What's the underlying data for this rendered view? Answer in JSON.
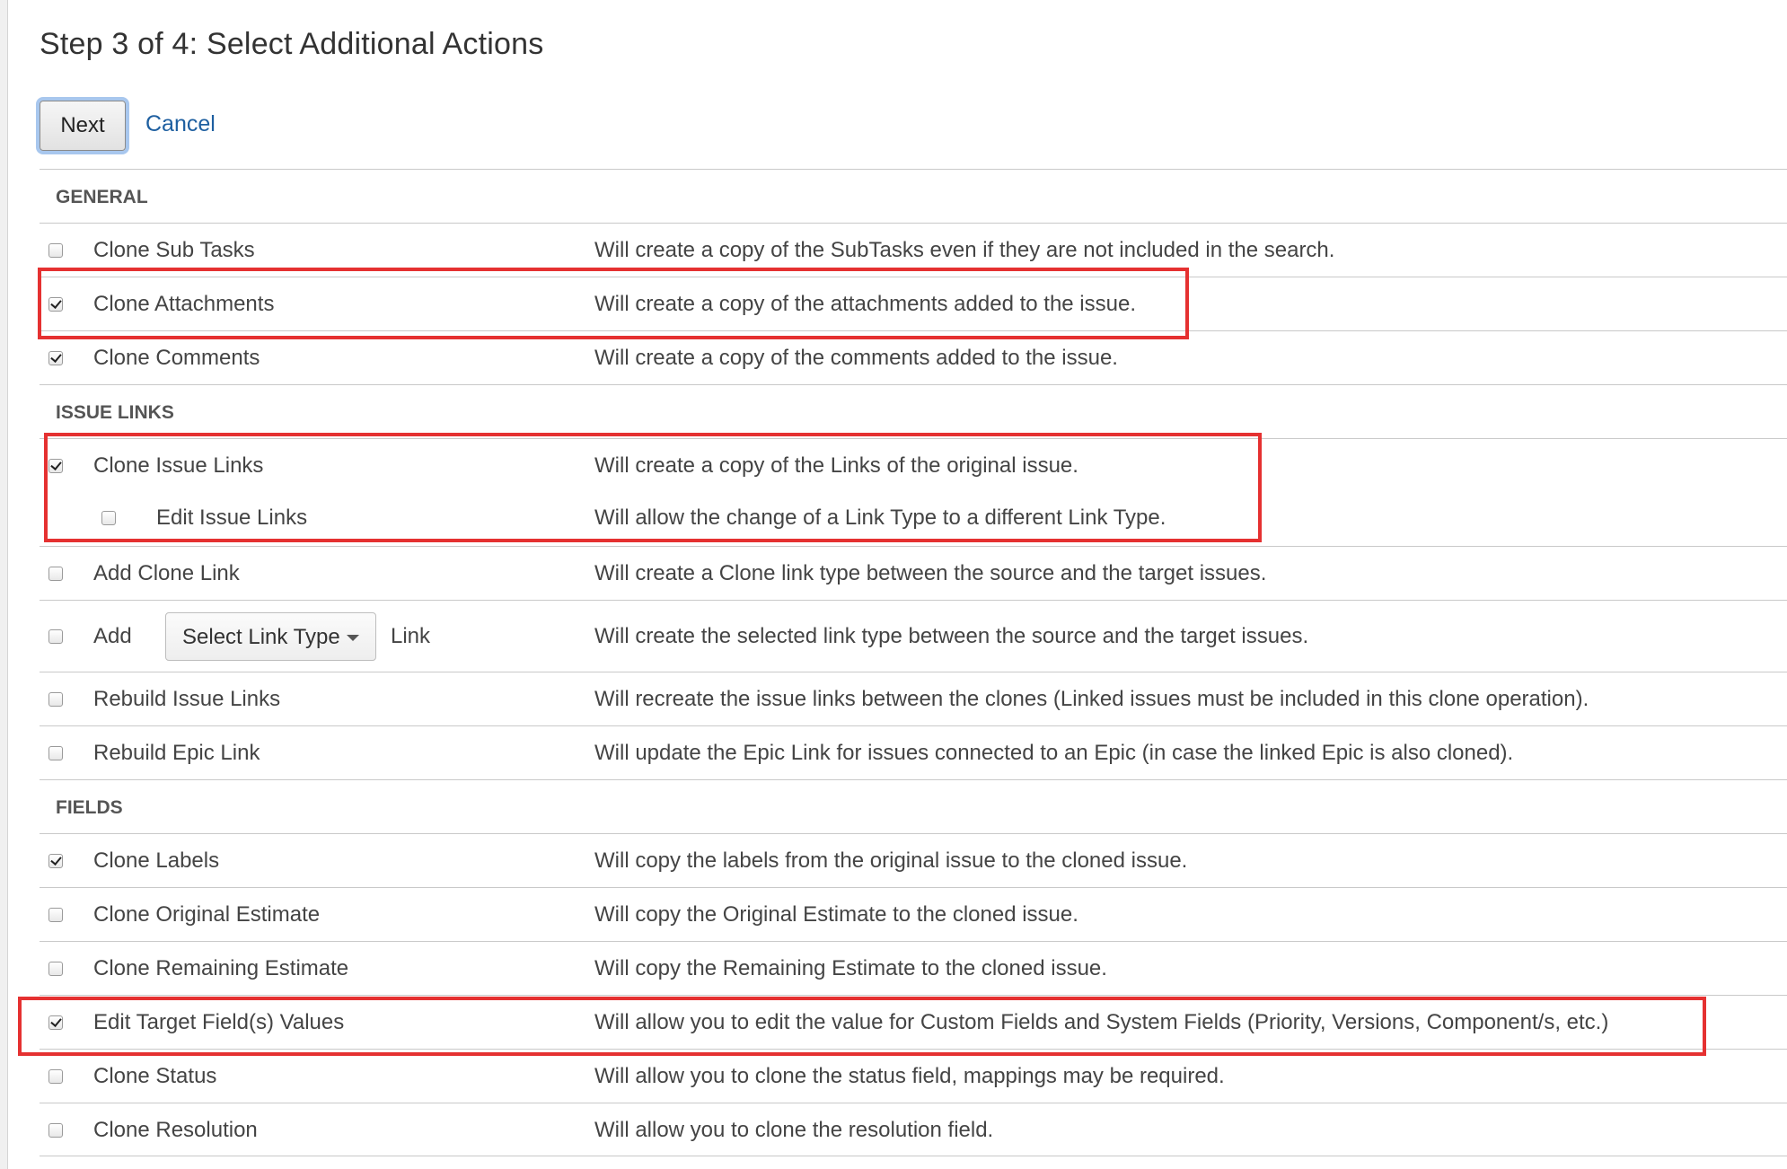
{
  "page": {
    "title": "Step 3 of 4: Select Additional Actions",
    "next_label": "Next",
    "cancel_label": "Cancel"
  },
  "sections": {
    "general": "GENERAL",
    "issue_links": "ISSUE LINKS",
    "fields": "FIELDS"
  },
  "options": {
    "clone_sub_tasks": {
      "label": "Clone Sub Tasks",
      "desc": "Will create a copy of the SubTasks even if they are not included in the search.",
      "checked": false
    },
    "clone_attachments": {
      "label": "Clone Attachments",
      "desc": "Will create a copy of the attachments added to the issue.",
      "checked": true
    },
    "clone_comments": {
      "label": "Clone Comments",
      "desc": "Will create a copy of the comments added to the issue.",
      "checked": true
    },
    "clone_issue_links": {
      "label": "Clone Issue Links",
      "desc": "Will create a copy of the Links of the original issue.",
      "checked": true
    },
    "edit_issue_links": {
      "label": "Edit Issue Links",
      "desc": "Will allow the change of a Link Type to a different Link Type.",
      "checked": false
    },
    "add_clone_link": {
      "label": "Add Clone Link",
      "desc": "Will create a Clone link type between the source and the target issues.",
      "checked": false
    },
    "add_link": {
      "prefix": "Add",
      "select_value": "Select Link Type",
      "suffix": "Link",
      "desc": "Will create the selected link type between the source and the target issues.",
      "checked": false
    },
    "rebuild_issue_links": {
      "label": "Rebuild Issue Links",
      "desc": "Will recreate the issue links between the clones (Linked issues must be included in this clone operation).",
      "checked": false
    },
    "rebuild_epic_link": {
      "label": "Rebuild Epic Link",
      "desc": "Will update the Epic Link for issues connected to an Epic (in case the linked Epic is also cloned).",
      "checked": false
    },
    "clone_labels": {
      "label": "Clone Labels",
      "desc": "Will copy the labels from the original issue to the cloned issue.",
      "checked": true
    },
    "clone_original_estimate": {
      "label": "Clone Original Estimate",
      "desc": "Will copy the Original Estimate to the cloned issue.",
      "checked": false
    },
    "clone_remaining_estimate": {
      "label": "Clone Remaining Estimate",
      "desc": "Will copy the Remaining Estimate to the cloned issue.",
      "checked": false
    },
    "edit_target_field_values": {
      "label": "Edit Target Field(s) Values",
      "desc": "Will allow you to edit the value for Custom Fields and System Fields (Priority, Versions, Component/s, etc.)",
      "checked": true
    },
    "clone_status": {
      "label": "Clone Status",
      "desc": "Will allow you to clone the status field, mappings may be required.",
      "checked": false
    },
    "clone_resolution": {
      "label": "Clone Resolution",
      "desc": "Will allow you to clone the resolution field.",
      "checked": false
    }
  },
  "colors": {
    "highlight": "#e53131",
    "link": "#1e5fa0",
    "focus_ring": "#a8c7ee"
  }
}
